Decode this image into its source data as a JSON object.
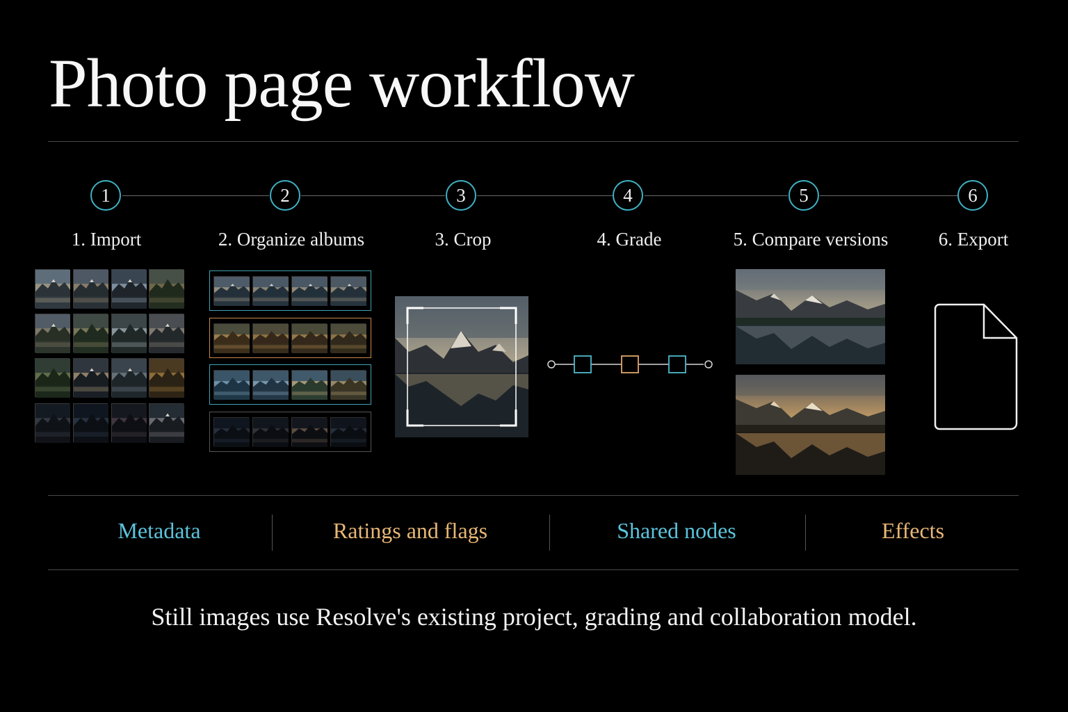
{
  "title": "Photo page workflow",
  "steps": [
    {
      "number": "1",
      "label": "1. Import"
    },
    {
      "number": "2",
      "label": "2. Organize albums"
    },
    {
      "number": "3",
      "label": "3. Crop"
    },
    {
      "number": "4",
      "label": "4. Grade"
    },
    {
      "number": "5",
      "label": "5. Compare versions"
    },
    {
      "number": "6",
      "label": "6. Export"
    }
  ],
  "features": [
    {
      "label": "Metadata",
      "color": "#5cc3dc"
    },
    {
      "label": "Ratings and flags",
      "color": "#e8b776"
    },
    {
      "label": "Shared nodes",
      "color": "#5cc3dc"
    },
    {
      "label": "Effects",
      "color": "#e8b776"
    }
  ],
  "footer": "Still images use Resolve's existing project, grading and collaboration model.",
  "colors": {
    "accent_blue": "#3fb1c4",
    "accent_orange": "#e0a468",
    "background": "#000000"
  },
  "icons": {
    "grade": "node-graph-icon",
    "export": "document-icon"
  }
}
